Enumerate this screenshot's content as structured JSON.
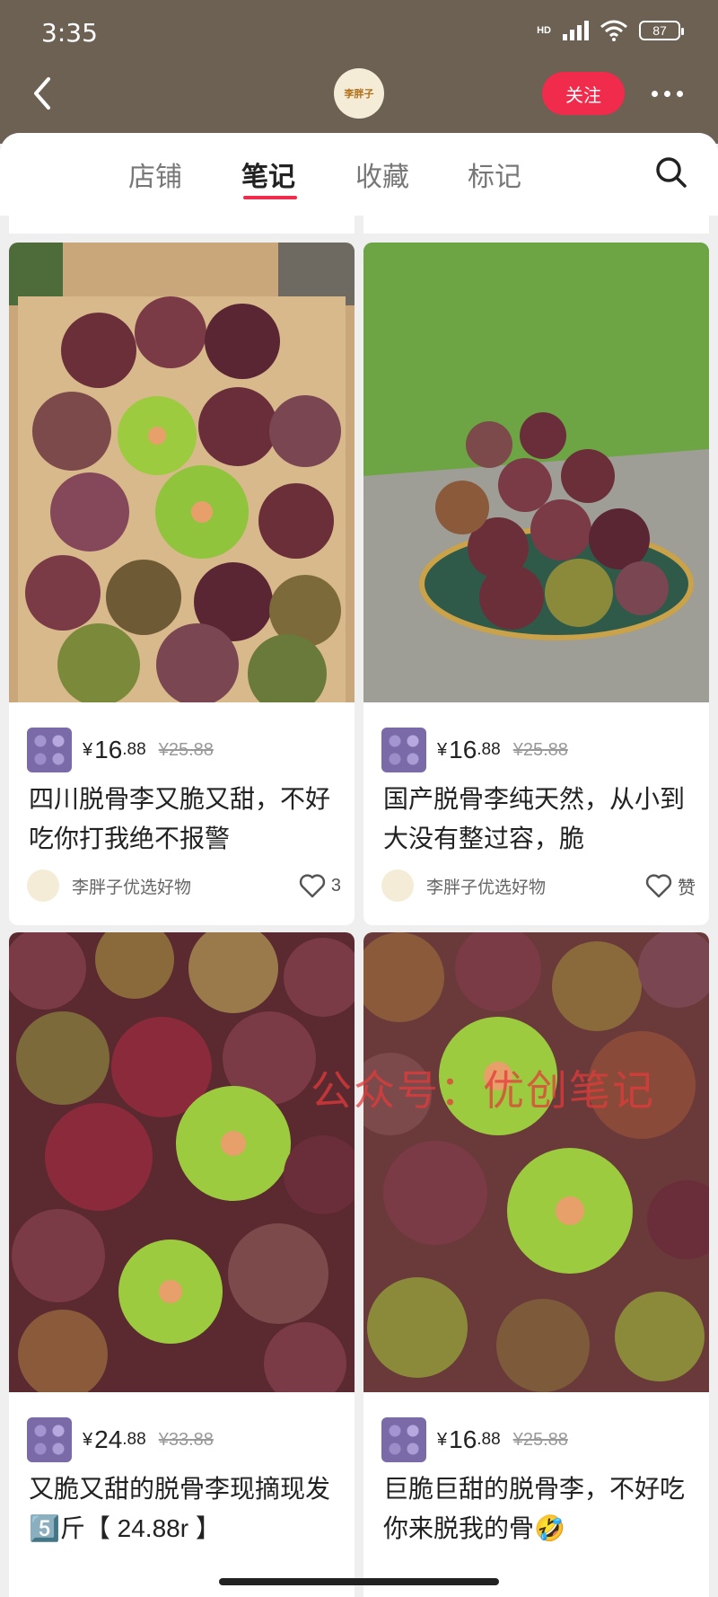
{
  "status": {
    "time": "3:35",
    "hd": "HD",
    "battery": "87"
  },
  "header": {
    "logo_text": "李胖子",
    "follow_label": "关注"
  },
  "tabs": [
    {
      "label": "店铺"
    },
    {
      "label": "笔记"
    },
    {
      "label": "收藏"
    },
    {
      "label": "标记"
    }
  ],
  "watermark": "公众号：优创笔记",
  "cards": [
    {
      "image": "box-of-plums-photo",
      "yen": "¥",
      "price_int": "16",
      "price_dec": ".88",
      "original": "¥25.88",
      "title": "四川脱骨李又脆又甜，不好吃你打我绝不报警",
      "author": "李胖子优选好物",
      "likes": "3"
    },
    {
      "image": "plate-of-plums-on-grass-photo",
      "yen": "¥",
      "price_int": "16",
      "price_dec": ".88",
      "original": "¥25.88",
      "title": "国产脱骨李纯天然，从小到大没有整过容，脆",
      "author": "李胖子优选好物",
      "likes": "赞"
    },
    {
      "image": "pile-of-plums-halved-photo",
      "yen": "¥",
      "price_int": "24",
      "price_dec": ".88",
      "original": "¥33.88",
      "title": "又脆又甜的脱骨李现摘现发5️⃣斤【 24.88r 】",
      "author": "",
      "likes": ""
    },
    {
      "image": "plums-halved-closeup-photo",
      "yen": "¥",
      "price_int": "16",
      "price_dec": ".88",
      "original": "¥25.88",
      "title": "巨脆巨甜的脱骨李，不好吃你来脱我的骨🤣",
      "author": "",
      "likes": ""
    }
  ]
}
